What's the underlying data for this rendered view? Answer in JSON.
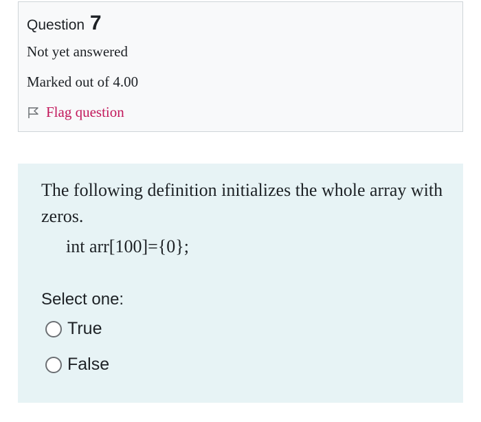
{
  "info": {
    "question_word": "Question",
    "question_number": "7",
    "state": "Not yet answered",
    "grade": "Marked out of 4.00",
    "flag_label": "Flag question"
  },
  "question": {
    "text": "The following definition initializes the whole array with zeros.",
    "code": "int arr[100]={0};",
    "prompt": "Select one:",
    "options": [
      {
        "label": "True",
        "selected": false
      },
      {
        "label": "False",
        "selected": false
      }
    ]
  },
  "colors": {
    "info_bg": "#f8f9fa",
    "content_bg": "#e7f3f5",
    "flag_link": "#c2185b"
  }
}
